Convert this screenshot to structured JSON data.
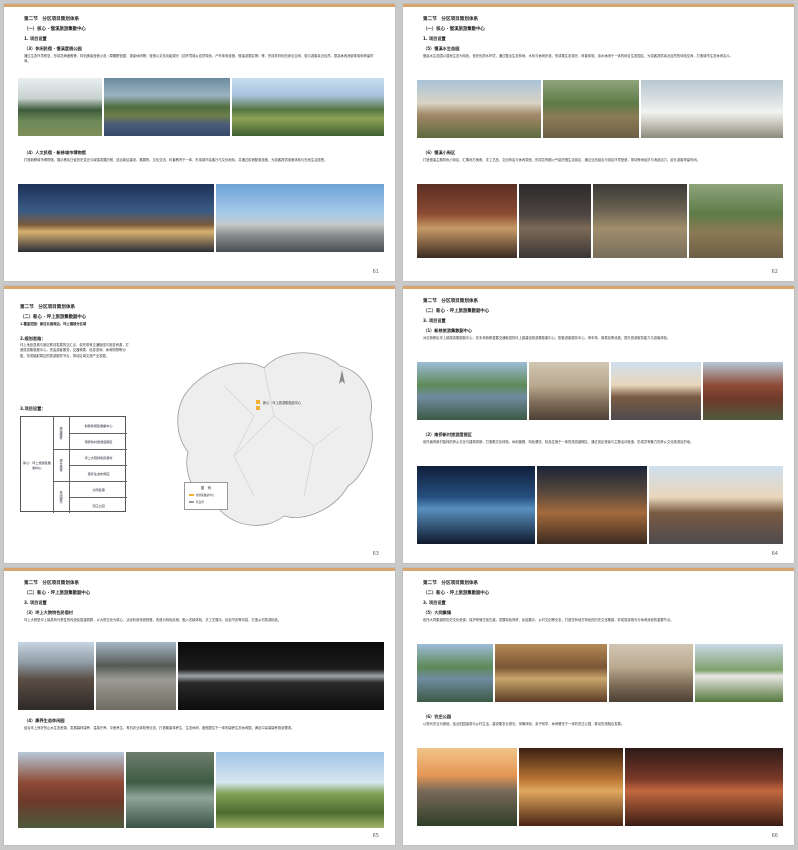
{
  "colors": {
    "accent_line": "#d8a56a",
    "page_bg": "#ffffff",
    "backdrop": "#c9c9c9"
  },
  "p1": {
    "section": "第二节　分区项目策划体系",
    "sub": "（一）核心 · 慢溪旅游集散中心",
    "item": "1. 项目设置",
    "h_a": "（3）休闲民宿 · 慢溪度假公园",
    "para_a": "通过生态环境修复，形成花海度假等，特色美景营造小品（草棚野营屋、观景休闲等）营造以文化功能观光（如环境城乡自然特色、户外体验设施、慢溪游憩区等）等，形成多样化的综合空间，吸引游客亲近自然，提高休闲消费体验和停留时间。",
    "h_b": "（4）人文民宿 · 新移城市博物馆",
    "para_b": "打造新移城市博物馆，展示移民迁徙历史变迁与城镇发展历程，结合新区建设，集展陈、文化交流、科普教育于一体，形成城市会客厅与文化地标，并通过民宿配套设施，为游客提供深度体验与在地生活感受。",
    "page": "61"
  },
  "p2": {
    "section": "第二节　分区项目策划体系",
    "sub": "（一）核心 · 慢溪旅游集散中心",
    "item": "1. 项目设置",
    "h_a": "（5）慢溪水生态园",
    "para_a": "慢溪水生态园以湿地生态为特色，依托优质水环境，通过整合生态林地、水系与休闲步道，形成集生态观光、科普体验、亲水休闲于一体的综合生态园区，为游客提供亲近自然的体验空间，打造城市生态休闲名片。",
    "h_b": "（6）慢溪小街区",
    "para_b": "打造慢溪主题特色小街区，汇集地方美食、手工艺品、文创商店与休闲茶座，形成富有烟火气息的慢生活街区，通过业态组合与街区环境营造，带动夜间经济与消费活力，延长游客停留时间。",
    "page": "62"
  },
  "p3": {
    "section": "第二节　分区项目策划体系",
    "sub": "（二）新心 · 坪上旅游集散副中心",
    "item1": "1.覆盖范围：新区北面周边，坪上镇部分区域",
    "item2": "2.规划思路：",
    "para": "坪上地处县城与新区联动发展的交汇点，依托现有交通枢纽与旅游资源，打造旅游集散副中心，完善游客服务、交通换乘、信息咨询、休闲购物等功能，形成辐射周边的旅游服务节点，带动区域文旅产业发展。",
    "item3": "3.项目设置：",
    "table": {
      "left": "新心 · 坪上旅游集散副中心",
      "g1": "旅游服务",
      "g2": "观光旅游",
      "g3": "休闲娱乐",
      "r1": "新移旅游集散副中心",
      "r2": "南侨新村旅游度假区",
      "r3": "坪上大院特色民宿村",
      "r4": "康养生态休闲园",
      "r5": "大同集镇",
      "r6": "农庄公园"
    },
    "map_label": "新心 · 坪上旅游集散副中心",
    "legend_title": "图　例",
    "legend_a": "旅游集散副中心",
    "legend_b": "区县界",
    "page": "63"
  },
  "p4": {
    "section": "第二节　分区项目策划体系",
    "sub": "（二）新心 · 坪上旅游集散副中心",
    "item": "3. 项目设置",
    "h_a": "（1）新移旅游集散副中心",
    "para_a": "对位新移区坪上镇旅游集散副中心，在未来新移重要交通枢纽的坪上镇建设旅游集散副中心，配套游客服务中心、停车场、换乘站等设施，提升旅游服务能力与游客体验。",
    "h_b": "（2）南侨新村旅游度假区",
    "para_b": "依托南侨新村独特的侨乡文化与建筑风貌，打造集文化体验、休闲度假、特色餐饮、精品住宿于一体的旅游度假区，通过街区夜景与主题活动营造，形成富有魅力的侨乡文化旅游目的地。",
    "page": "64"
  },
  "p5": {
    "section": "第二节　分区项目策划体系",
    "sub": "（二）新心 · 坪上旅游集散副中心",
    "item": "3. 项目设置",
    "h_a": "（3）坪上大院特色民宿村",
    "para_a": "坪上大院是坪上镇具有代表性的传统民居建筑群，以大院文化为核心，活化利用传统院落，改造为特色民宿，融入农耕体验、手工艺展示、民俗节庆等内容，打造乡村旅游精品。",
    "h_b": "（4）康养生态休闲园",
    "para_b": "结合坪上良好的山水生态资源，发展森林康养、温泉疗养、中医养生、有机农业体验等业态，打造集康体养生、生态休闲、度假居住于一体的康养生态休闲园，满足中高端康养旅游需求。",
    "page": "65"
  },
  "p6": {
    "section": "第二节　分区项目策划体系",
    "sub": "（二）新心 · 坪上旅游集散副中心",
    "item": "3. 项目设置",
    "h_a": "（5）大同集镇",
    "para_a": "依托大同集镇的历史文化资源，保护修缮古街古建，发展特色商贸、民俗展示、乡村文创等业态，打造富有地方特色的历史文化集镇，形成旅游观光与休闲消费的重要节点。",
    "h_b": "（6）农庄公园",
    "para_b": "以现代农业为基础，结合田园景观与乡村生活，建设集农业观光、采摘体验、亲子研学、休闲餐饮于一体的农庄公园，推动农旅融合发展。",
    "page": "66"
  }
}
